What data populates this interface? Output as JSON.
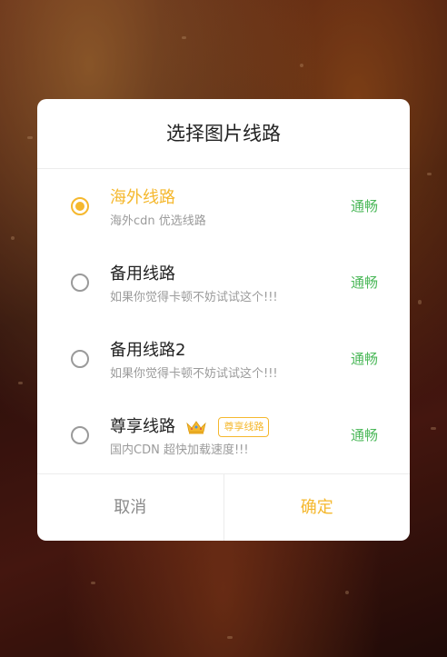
{
  "dialog": {
    "title": "选择图片线路",
    "options": [
      {
        "name": "海外线路",
        "desc": "海外cdn 优选线路",
        "status": "通畅",
        "selected": true
      },
      {
        "name": "备用线路",
        "desc": "如果你觉得卡顿不妨试试这个!!!",
        "status": "通畅",
        "selected": false
      },
      {
        "name": "备用线路2",
        "desc": "如果你觉得卡顿不妨试试这个!!!",
        "status": "通畅",
        "selected": false
      },
      {
        "name": "尊享线路",
        "badge": "尊享线路",
        "icon": "crown-icon",
        "desc": "国内CDN 超快加载速度!!!",
        "status": "通畅",
        "selected": false
      }
    ],
    "cancel_label": "取消",
    "confirm_label": "确定"
  },
  "colors": {
    "accent": "#f5b82e",
    "status_ok": "#4cb85a",
    "text_primary": "#222222",
    "text_secondary": "#9b9b9b"
  }
}
